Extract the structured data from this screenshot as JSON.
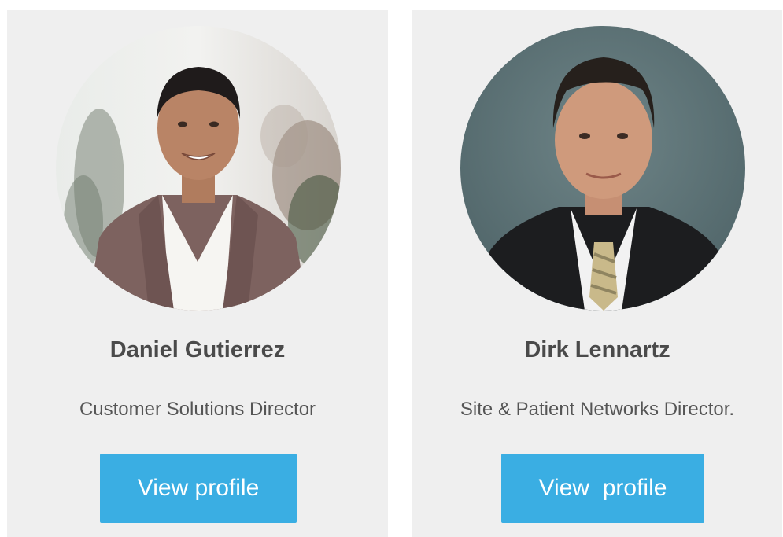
{
  "profiles": [
    {
      "name": "Daniel Gutierrez",
      "role": "Customer Solutions Director",
      "button_label": "View profile"
    },
    {
      "name": "Dirk Lennartz",
      "role": "Site & Patient Networks Director.",
      "button_label": "View  profile"
    }
  ],
  "colors": {
    "card_background": "#efefef",
    "button": "#3aaee3",
    "name_text": "#4a4a4a",
    "role_text": "#555555"
  }
}
